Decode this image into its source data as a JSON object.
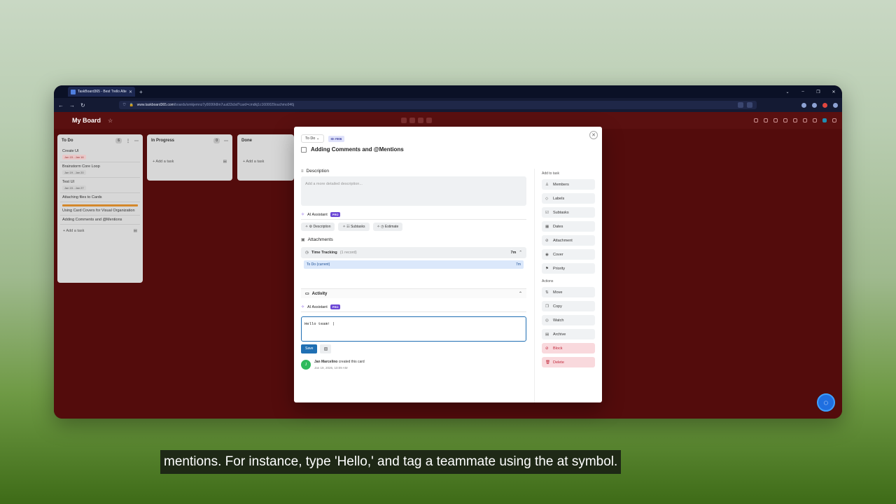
{
  "browser": {
    "tab_title": "TaskBoard365 - Best Trello Alte",
    "url_domain": "www.taskboard365.com",
    "url_path": "/boards/smkjemnz7y0006h8m7uuii33cbd?card=cmdkj1c1600029ouchmo946j"
  },
  "board": {
    "title": "My Board",
    "columns": [
      {
        "name": "To Do",
        "count": "6",
        "add": "+ Add a task",
        "cards": [
          {
            "title": "Create UI",
            "date": "Jan 15 - Jan 16"
          },
          {
            "title": "Brainstorm Core Loop",
            "date": "Jan 19 - Jan 20"
          },
          {
            "title": "Test UI",
            "date": "Jan 15 - Jan 27"
          },
          {
            "title": "Attaching files to Cards",
            "date": ""
          },
          {
            "title": "Using Card Covers for Visual Organization",
            "date": ""
          },
          {
            "title": "Adding Comments and @Mentions",
            "date": ""
          }
        ]
      },
      {
        "name": "In Progress",
        "count": "0",
        "add": "+ Add a task"
      },
      {
        "name": "Done",
        "add": "+ Add a task"
      }
    ]
  },
  "modal": {
    "status": "To Do ⌄",
    "id_badge": "ID #006",
    "title": "Adding Comments and @Mentions",
    "description": {
      "heading": "Description",
      "placeholder": "Add a more detailed description..."
    },
    "ai_label": "AI Assistant",
    "pro": "PRO",
    "ai_buttons": [
      "⚙ Description",
      "☷ Subtasks",
      "◷ Estimate"
    ],
    "attachments_heading": "Attachments",
    "time_tracking": {
      "label": "Time Tracking",
      "sub": "(1 record)",
      "total": "7m",
      "row_label": "To Do (current)",
      "row_value": "7m"
    },
    "activity": {
      "heading": "Activity",
      "comment_value": "Hello team! |",
      "save_label": "Save",
      "entry": {
        "initial": "J",
        "name": "Jan Marcelino",
        "action": "created this card",
        "time": "Jan 19, 2026, 10:09 AM"
      }
    },
    "sidebar": {
      "add_heading": "Add to task",
      "add_items": [
        {
          "icon": "♙",
          "label": "Members"
        },
        {
          "icon": "◇",
          "label": "Labels"
        },
        {
          "icon": "☑",
          "label": "Subtasks"
        },
        {
          "icon": "▦",
          "label": "Dates"
        },
        {
          "icon": "⊘",
          "label": "Attachment"
        },
        {
          "icon": "◉",
          "label": "Cover"
        },
        {
          "icon": "⚑",
          "label": "Priority"
        }
      ],
      "actions_heading": "Actions",
      "action_items": [
        {
          "icon": "⇅",
          "label": "Move"
        },
        {
          "icon": "❐",
          "label": "Copy"
        },
        {
          "icon": "◎",
          "label": "Watch"
        },
        {
          "icon": "▤",
          "label": "Archive"
        },
        {
          "icon": "⊘",
          "label": "Block"
        },
        {
          "icon": "🗑",
          "label": "Delete"
        }
      ]
    }
  },
  "caption": "mentions. For instance, type 'Hello,' and tag a teammate using the at symbol."
}
